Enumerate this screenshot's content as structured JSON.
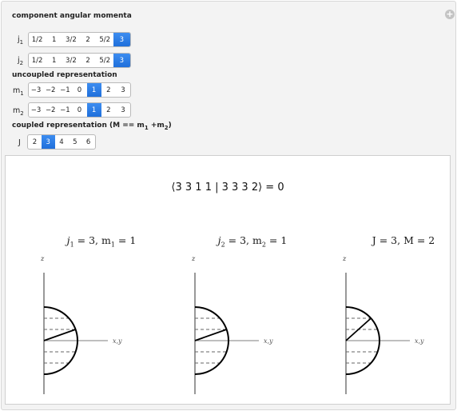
{
  "controls": {
    "section1_title": "component angular momenta",
    "j1": {
      "label": "j",
      "sub": "1",
      "options": [
        "1/2",
        "1",
        "3/2",
        "2",
        "5/2",
        "3"
      ],
      "selected": "3"
    },
    "j2": {
      "label": "j",
      "sub": "2",
      "options": [
        "1/2",
        "1",
        "3/2",
        "2",
        "5/2",
        "3"
      ],
      "selected": "3"
    },
    "section2_title": "uncoupled representation",
    "m1": {
      "label": "m",
      "sub": "1",
      "options": [
        "−3",
        "−2",
        "−1",
        "0",
        "1",
        "2",
        "3"
      ],
      "selected": "1"
    },
    "m2": {
      "label": "m",
      "sub": "2",
      "options": [
        "−3",
        "−2",
        "−1",
        "0",
        "1",
        "2",
        "3"
      ],
      "selected": "1"
    },
    "section3_title_pre": "coupled representation (M == m",
    "section3_sub1": "1",
    "section3_mid": " +m",
    "section3_sub2": "2",
    "section3_post": ")",
    "J": {
      "label": "J",
      "options": [
        "2",
        "3",
        "4",
        "5",
        "6"
      ],
      "selected": "3"
    }
  },
  "output": {
    "coefficient": "⟨3 3 1 1 | 3 3 3 2⟩ = 0",
    "axis_z": "z",
    "axis_xy": "x,y",
    "plots": [
      {
        "name": "plot-j1",
        "t1": "j",
        "t1sub": "1",
        "t1rest": " = 3,  m",
        "t2sub": "1",
        "t2rest": " = 1",
        "j": 3,
        "m": 1
      },
      {
        "name": "plot-j2",
        "t1": "j",
        "t1sub": "2",
        "t1rest": " = 3,  m",
        "t2sub": "2",
        "t2rest": " = 1",
        "j": 3,
        "m": 1
      },
      {
        "name": "plot-J",
        "t1": "J = 3,  M = 2",
        "t1sub": "",
        "t1rest": "",
        "t2sub": "",
        "t2rest": "",
        "j": 3,
        "m": 2
      }
    ]
  },
  "colors": {
    "selected": "#2a7be4",
    "line": "#000000",
    "dash": "#555555",
    "panel": "#f3f3f3"
  },
  "icons": {
    "plus": "plus-circle-icon"
  }
}
